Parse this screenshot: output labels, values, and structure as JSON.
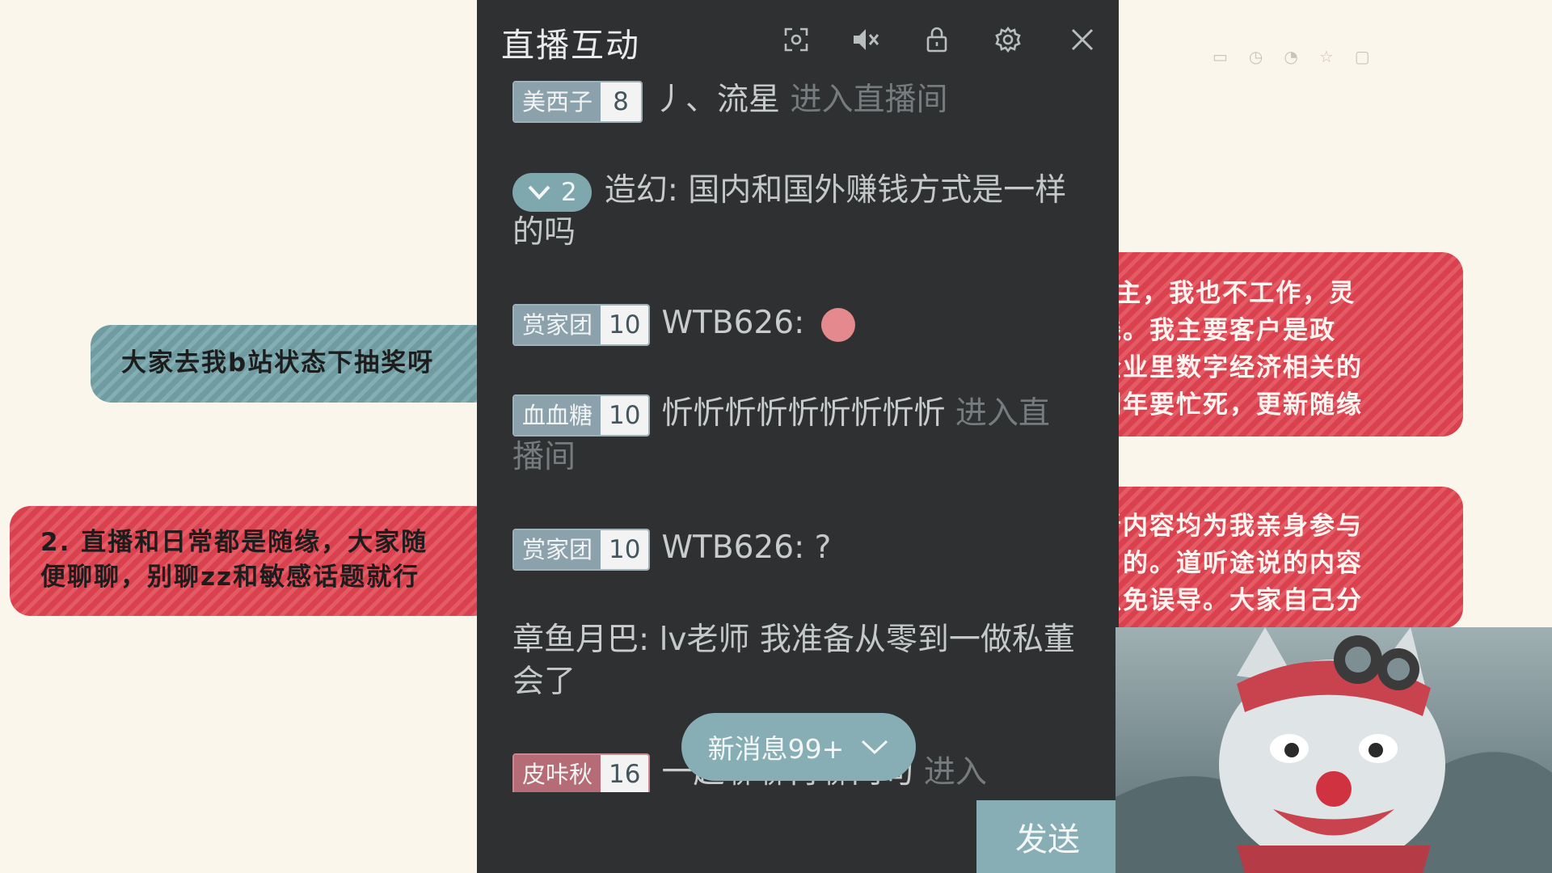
{
  "notes": {
    "blue": "大家去我b站状态下抽奖呀",
    "red_left": [
      "2. 直播和日常都是随缘，大家随",
      "便聊聊，别聊zz和敏感话题就行"
    ],
    "red_right_1": [
      "p主，我也不工作，灵",
      "线。我主要客户是政",
      "企业里数字经济相关的",
      "明年要忙死，更新随缘"
    ],
    "red_right_2": [
      "新内容均为我亲身参与",
      "与的。道听途说的内容",
      "以免误导。大家自己分"
    ]
  },
  "panel": {
    "title": "直播互动",
    "icons": [
      "expand-icon",
      "mute-icon",
      "lock-icon",
      "settings-icon",
      "close-icon"
    ]
  },
  "messages": [
    {
      "badge": "美西子",
      "level": "8",
      "user": "丿、流星",
      "text": "",
      "enter": "进入直播间"
    },
    {
      "vip": "2",
      "user": "造幻",
      "text": "国内和国外赚钱方式是一样的吗"
    },
    {
      "badge": "赏家团",
      "level": "10",
      "user": "WTB626",
      "text": ""
    },
    {
      "badge": "血血糖",
      "level": "10",
      "user": "忻忻忻忻忻忻忻忻忻",
      "text": "",
      "enter": "进入直播间"
    },
    {
      "badge": "赏家团",
      "level": "10",
      "user": "WTB626",
      "text": "?"
    },
    {
      "user": "章鱼月巴",
      "text": "lv老师 我准备从零到一做私董会了"
    },
    {
      "badge": "皮咔秋",
      "level": "16",
      "user": "一起聊聊再聊两句",
      "text": "",
      "enter": "进入"
    }
  ],
  "new_messages": "新消息99+",
  "send": "发送"
}
